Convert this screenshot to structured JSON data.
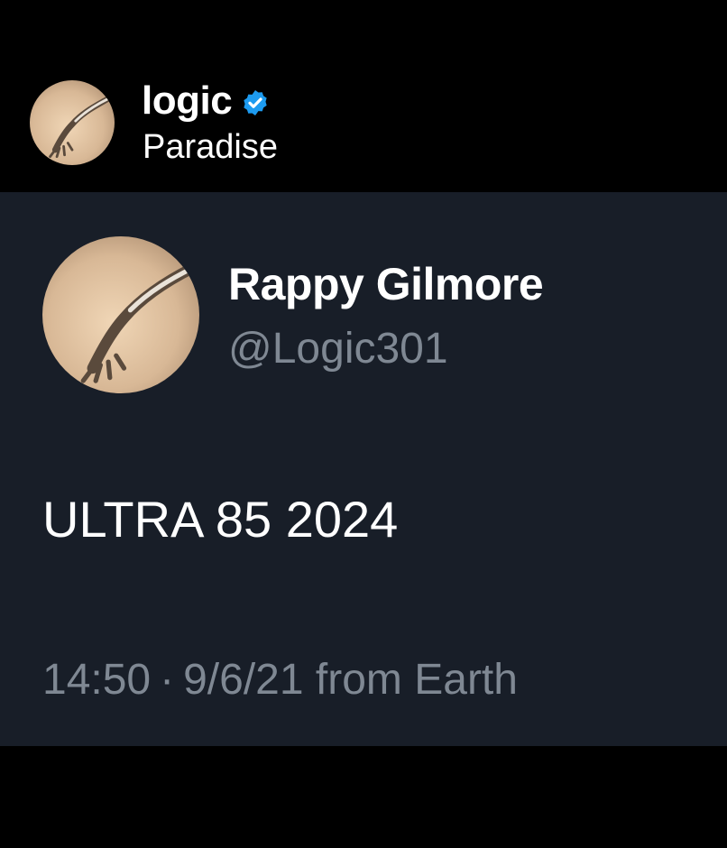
{
  "colors": {
    "page_background": "#000000",
    "card_background": "#181e28",
    "primary_text": "#ffffff",
    "secondary_text": "#7f8893",
    "verified_badge": "#1d9bf0",
    "avatar_tone": "#d8b896"
  },
  "header": {
    "name": "logic",
    "subtitle": "Paradise",
    "verified": true,
    "avatar_icon": "profile-photo-icon",
    "badge_icon": "verified-badge-icon"
  },
  "tweet": {
    "display_name": "Rappy Gilmore",
    "handle": "@Logic301",
    "avatar_icon": "profile-photo-icon",
    "text": "ULTRA 85 2024",
    "time": "14:50",
    "separator": "·",
    "date_source": "9/6/21 from Earth"
  }
}
